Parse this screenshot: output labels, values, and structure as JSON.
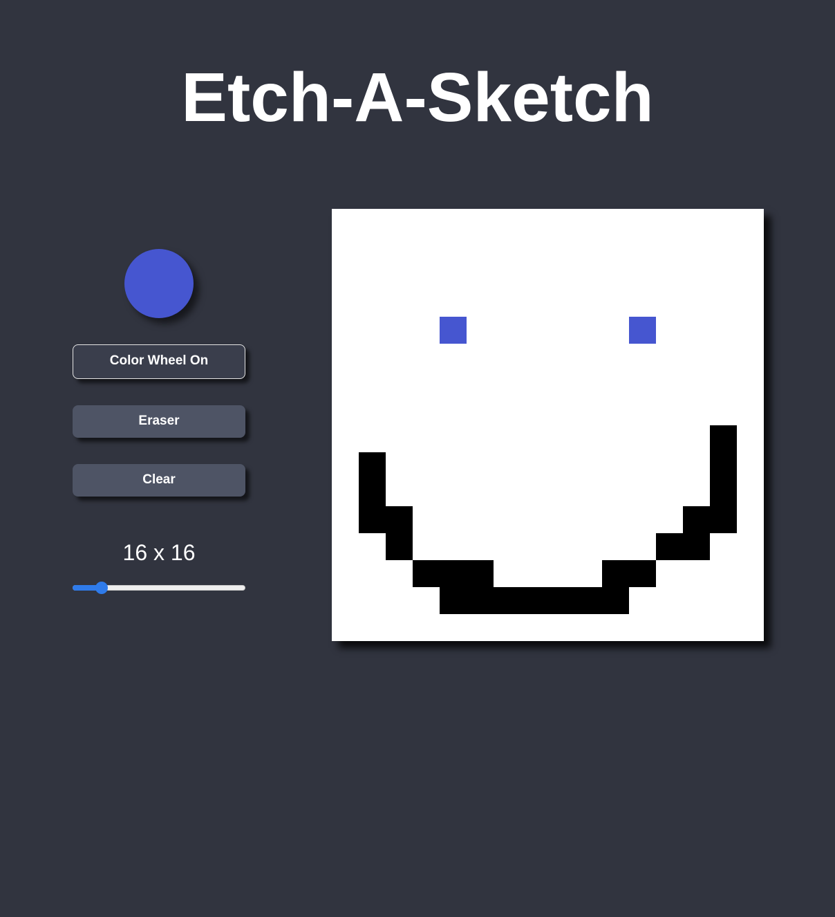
{
  "app": {
    "title": "Etch-A-Sketch"
  },
  "colors": {
    "background": "#31343f",
    "current_color": "#4656d0",
    "blank": "#ffffff",
    "ink_black": "#000000",
    "slider_accent": "#2f7bea"
  },
  "controls": {
    "color_wheel_label": "Color Wheel On",
    "eraser_label": "Eraser",
    "clear_label": "Clear",
    "grid_size_label": "16 x 16",
    "grid_size_value": 16,
    "grid_size_min": 2,
    "grid_size_max": 100
  },
  "grid": {
    "size": 16,
    "cells": [
      "................",
      "................",
      "................",
      "................",
      "....B......B....",
      "................",
      "................",
      "................",
      "..............K.",
      ".K............K.",
      ".K............K.",
      ".KK..........KK.",
      "..K.........KK..",
      "...KKK....KK....",
      "....KKKKKKK.....",
      "................"
    ],
    "legend": {
      ".": "blank",
      "B": "current_color",
      "K": "ink_black"
    }
  }
}
